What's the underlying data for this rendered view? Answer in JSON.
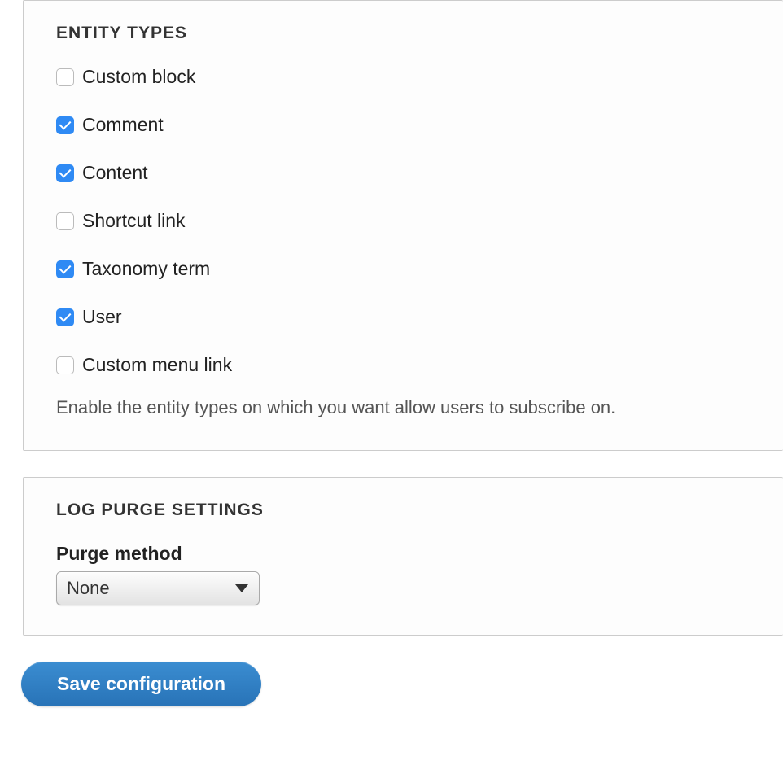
{
  "entity_types": {
    "legend": "Entity types",
    "items": [
      {
        "label": "Custom block",
        "checked": false
      },
      {
        "label": "Comment",
        "checked": true
      },
      {
        "label": "Content",
        "checked": true
      },
      {
        "label": "Shortcut link",
        "checked": false
      },
      {
        "label": "Taxonomy term",
        "checked": true
      },
      {
        "label": "User",
        "checked": true
      },
      {
        "label": "Custom menu link",
        "checked": false
      }
    ],
    "description": "Enable the entity types on which you want allow users to subscribe on."
  },
  "log_purge": {
    "legend": "Log purge settings",
    "purge_method_label": "Purge method",
    "purge_method_value": "None"
  },
  "actions": {
    "submit": "Save configuration"
  }
}
